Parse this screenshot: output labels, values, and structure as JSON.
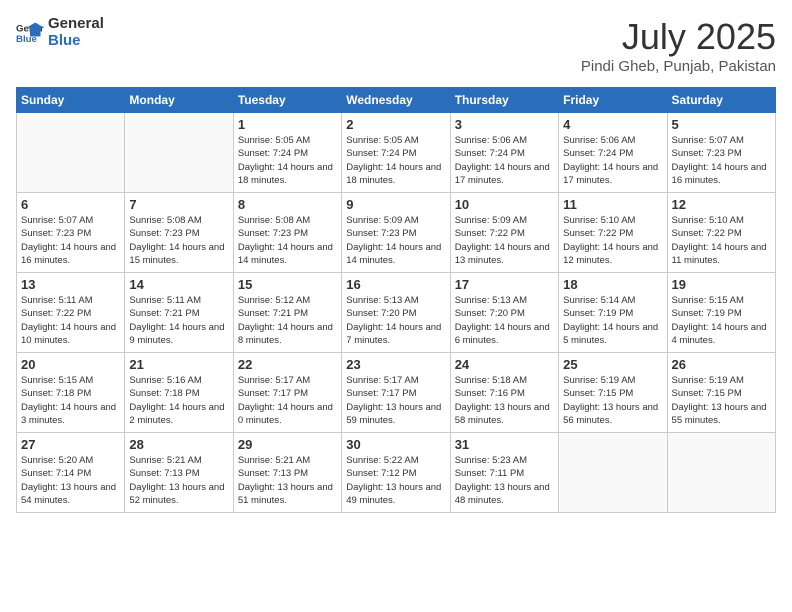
{
  "header": {
    "logo_general": "General",
    "logo_blue": "Blue",
    "title": "July 2025",
    "subtitle": "Pindi Gheb, Punjab, Pakistan"
  },
  "weekdays": [
    "Sunday",
    "Monday",
    "Tuesday",
    "Wednesday",
    "Thursday",
    "Friday",
    "Saturday"
  ],
  "weeks": [
    [
      {
        "day": "",
        "info": ""
      },
      {
        "day": "",
        "info": ""
      },
      {
        "day": "1",
        "info": "Sunrise: 5:05 AM\nSunset: 7:24 PM\nDaylight: 14 hours and 18 minutes."
      },
      {
        "day": "2",
        "info": "Sunrise: 5:05 AM\nSunset: 7:24 PM\nDaylight: 14 hours and 18 minutes."
      },
      {
        "day": "3",
        "info": "Sunrise: 5:06 AM\nSunset: 7:24 PM\nDaylight: 14 hours and 17 minutes."
      },
      {
        "day": "4",
        "info": "Sunrise: 5:06 AM\nSunset: 7:24 PM\nDaylight: 14 hours and 17 minutes."
      },
      {
        "day": "5",
        "info": "Sunrise: 5:07 AM\nSunset: 7:23 PM\nDaylight: 14 hours and 16 minutes."
      }
    ],
    [
      {
        "day": "6",
        "info": "Sunrise: 5:07 AM\nSunset: 7:23 PM\nDaylight: 14 hours and 16 minutes."
      },
      {
        "day": "7",
        "info": "Sunrise: 5:08 AM\nSunset: 7:23 PM\nDaylight: 14 hours and 15 minutes."
      },
      {
        "day": "8",
        "info": "Sunrise: 5:08 AM\nSunset: 7:23 PM\nDaylight: 14 hours and 14 minutes."
      },
      {
        "day": "9",
        "info": "Sunrise: 5:09 AM\nSunset: 7:23 PM\nDaylight: 14 hours and 14 minutes."
      },
      {
        "day": "10",
        "info": "Sunrise: 5:09 AM\nSunset: 7:22 PM\nDaylight: 14 hours and 13 minutes."
      },
      {
        "day": "11",
        "info": "Sunrise: 5:10 AM\nSunset: 7:22 PM\nDaylight: 14 hours and 12 minutes."
      },
      {
        "day": "12",
        "info": "Sunrise: 5:10 AM\nSunset: 7:22 PM\nDaylight: 14 hours and 11 minutes."
      }
    ],
    [
      {
        "day": "13",
        "info": "Sunrise: 5:11 AM\nSunset: 7:22 PM\nDaylight: 14 hours and 10 minutes."
      },
      {
        "day": "14",
        "info": "Sunrise: 5:11 AM\nSunset: 7:21 PM\nDaylight: 14 hours and 9 minutes."
      },
      {
        "day": "15",
        "info": "Sunrise: 5:12 AM\nSunset: 7:21 PM\nDaylight: 14 hours and 8 minutes."
      },
      {
        "day": "16",
        "info": "Sunrise: 5:13 AM\nSunset: 7:20 PM\nDaylight: 14 hours and 7 minutes."
      },
      {
        "day": "17",
        "info": "Sunrise: 5:13 AM\nSunset: 7:20 PM\nDaylight: 14 hours and 6 minutes."
      },
      {
        "day": "18",
        "info": "Sunrise: 5:14 AM\nSunset: 7:19 PM\nDaylight: 14 hours and 5 minutes."
      },
      {
        "day": "19",
        "info": "Sunrise: 5:15 AM\nSunset: 7:19 PM\nDaylight: 14 hours and 4 minutes."
      }
    ],
    [
      {
        "day": "20",
        "info": "Sunrise: 5:15 AM\nSunset: 7:18 PM\nDaylight: 14 hours and 3 minutes."
      },
      {
        "day": "21",
        "info": "Sunrise: 5:16 AM\nSunset: 7:18 PM\nDaylight: 14 hours and 2 minutes."
      },
      {
        "day": "22",
        "info": "Sunrise: 5:17 AM\nSunset: 7:17 PM\nDaylight: 14 hours and 0 minutes."
      },
      {
        "day": "23",
        "info": "Sunrise: 5:17 AM\nSunset: 7:17 PM\nDaylight: 13 hours and 59 minutes."
      },
      {
        "day": "24",
        "info": "Sunrise: 5:18 AM\nSunset: 7:16 PM\nDaylight: 13 hours and 58 minutes."
      },
      {
        "day": "25",
        "info": "Sunrise: 5:19 AM\nSunset: 7:15 PM\nDaylight: 13 hours and 56 minutes."
      },
      {
        "day": "26",
        "info": "Sunrise: 5:19 AM\nSunset: 7:15 PM\nDaylight: 13 hours and 55 minutes."
      }
    ],
    [
      {
        "day": "27",
        "info": "Sunrise: 5:20 AM\nSunset: 7:14 PM\nDaylight: 13 hours and 54 minutes."
      },
      {
        "day": "28",
        "info": "Sunrise: 5:21 AM\nSunset: 7:13 PM\nDaylight: 13 hours and 52 minutes."
      },
      {
        "day": "29",
        "info": "Sunrise: 5:21 AM\nSunset: 7:13 PM\nDaylight: 13 hours and 51 minutes."
      },
      {
        "day": "30",
        "info": "Sunrise: 5:22 AM\nSunset: 7:12 PM\nDaylight: 13 hours and 49 minutes."
      },
      {
        "day": "31",
        "info": "Sunrise: 5:23 AM\nSunset: 7:11 PM\nDaylight: 13 hours and 48 minutes."
      },
      {
        "day": "",
        "info": ""
      },
      {
        "day": "",
        "info": ""
      }
    ]
  ]
}
